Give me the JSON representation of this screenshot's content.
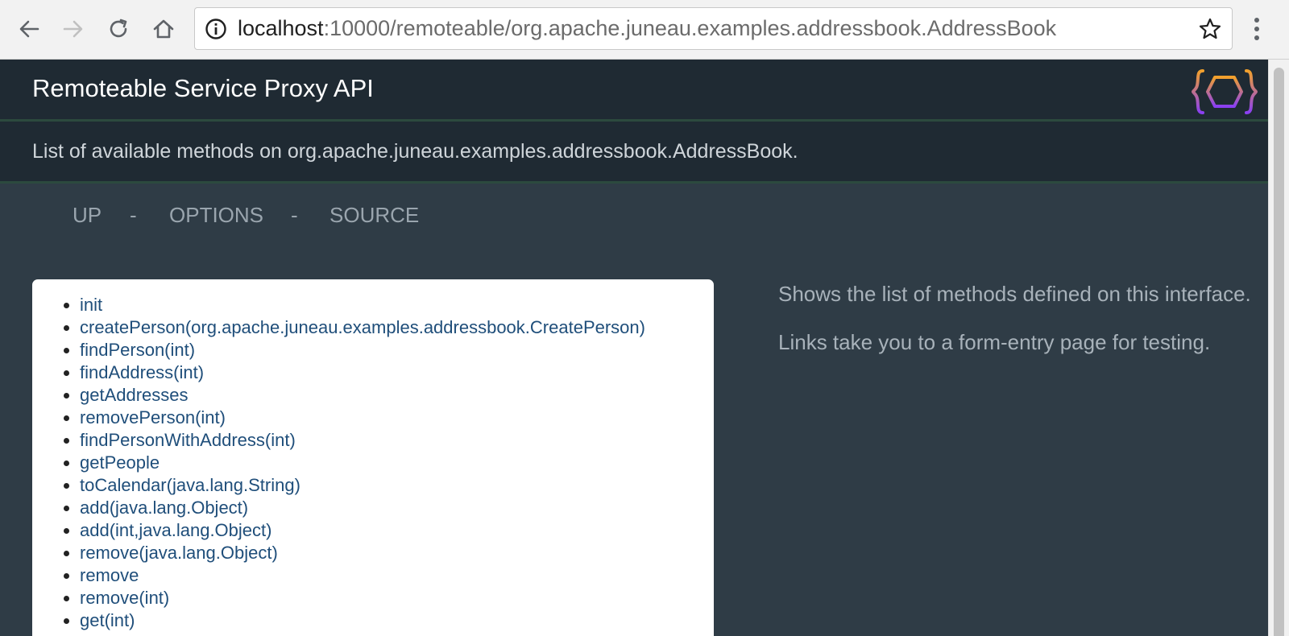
{
  "browser": {
    "url_host": "localhost",
    "url_rest": ":10000/remoteable/org.apache.juneau.examples.addressbook.AddressBook"
  },
  "header": {
    "title": "Remoteable Service Proxy API"
  },
  "subheader": {
    "description": "List of available methods on org.apache.juneau.examples.addressbook.AddressBook."
  },
  "nav": {
    "links": [
      "UP",
      "OPTIONS",
      "SOURCE"
    ],
    "separator": "-"
  },
  "methods": [
    "init",
    "createPerson(org.apache.juneau.examples.addressbook.CreatePerson)",
    "findPerson(int)",
    "findAddress(int)",
    "getAddresses",
    "removePerson(int)",
    "findPersonWithAddress(int)",
    "getPeople",
    "toCalendar(java.lang.String)",
    "add(java.lang.Object)",
    "add(int,java.lang.Object)",
    "remove(java.lang.Object)",
    "remove",
    "remove(int)",
    "get(int)"
  ],
  "aside": {
    "paragraph1": "Shows the list of methods defined on this interface.",
    "paragraph2": "Links take you to a form-entry page for testing."
  },
  "colors": {
    "header_bg": "#1f2a33",
    "page_bg": "#2f3c46",
    "link": "#1f4e7a",
    "logo_orange": "#f08a24",
    "logo_purple": "#8a3ff2"
  }
}
